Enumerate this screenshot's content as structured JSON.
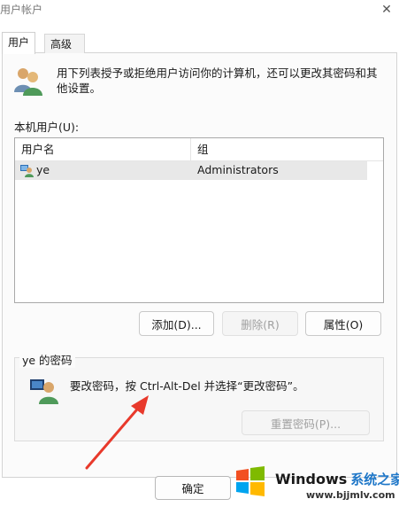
{
  "window": {
    "title": "用户帐户",
    "close_glyph": "✕"
  },
  "tabs": [
    {
      "label": "用户",
      "active": true
    },
    {
      "label": "高级",
      "active": false
    }
  ],
  "intro": {
    "text": "用下列表授予或拒绝用户访问你的计算机，还可以更改其密码和其他设置。",
    "icon": "users-icon"
  },
  "users_section": {
    "label": "本机用户(U):",
    "columns": [
      "用户名",
      "组"
    ],
    "rows": [
      {
        "name": "ye",
        "group": "Administrators",
        "icon": "user-admin-icon"
      }
    ]
  },
  "buttons": {
    "add": "添加(D)...",
    "delete": "删除(R)",
    "properties": "属性(O)"
  },
  "password_section": {
    "title": "ye 的密码",
    "text": "要改密码，按 Ctrl-Alt-Del 并选择“更改密码”。",
    "reset_button": "重置密码(P)...",
    "icon": "user-key-icon"
  },
  "footer": {
    "ok": "确定"
  },
  "watermark": {
    "brand": "Windows",
    "brand_cn": "系统之家",
    "url": "www.bjjmlv.com"
  },
  "annotation": {
    "arrow_color": "#e8392b"
  },
  "colors": {
    "accent": "#1f77c8",
    "list_selection": "#e8e8e8"
  }
}
